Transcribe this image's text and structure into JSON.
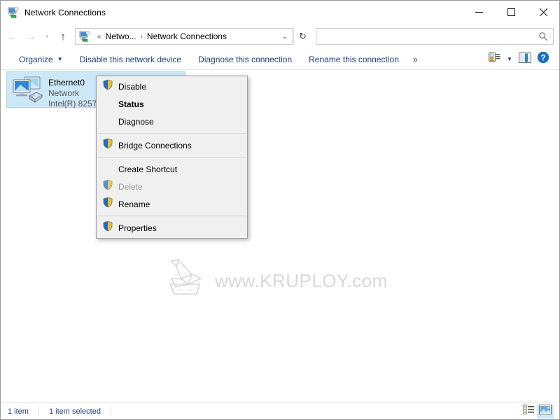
{
  "window": {
    "title": "Network Connections",
    "title_icon": "network-connections-icon",
    "minimize_label": "Minimize",
    "maximize_label": "Maximize",
    "close_label": "Close"
  },
  "navigation": {
    "back_label": "Back",
    "forward_label": "Forward",
    "recent_label": "Recent locations",
    "up_label": "Up",
    "refresh_label": "Refresh"
  },
  "address": {
    "icon": "network-connections-icon",
    "prefix": "«",
    "crumb1": "Netwo...",
    "separator": "›",
    "crumb2": "Network Connections",
    "dropdown": "⌄"
  },
  "search": {
    "value": "",
    "placeholder": "",
    "icon": "search-icon"
  },
  "toolbar": {
    "organize": "Organize",
    "organize_caret": "▼",
    "disable_device": "Disable this network device",
    "diagnose_connection": "Diagnose this connection",
    "rename_connection": "Rename this connection",
    "overflow": "»",
    "view_options": "change-view-icon",
    "view_caret": "▼",
    "preview_pane": "preview-pane-icon",
    "help": "?"
  },
  "items": [
    {
      "name": "Ethernet0",
      "network": "Network",
      "adapter": "Intel(R) 8257",
      "icon": "lan-connection-icon",
      "selected": true
    }
  ],
  "context_menu": [
    {
      "label": "Disable",
      "shield": true,
      "bold": false,
      "disabled": false,
      "sep_after": false
    },
    {
      "label": "Status",
      "shield": false,
      "bold": true,
      "disabled": false,
      "sep_after": false
    },
    {
      "label": "Diagnose",
      "shield": false,
      "bold": false,
      "disabled": false,
      "sep_after": true
    },
    {
      "label": "Bridge Connections",
      "shield": true,
      "bold": false,
      "disabled": false,
      "sep_after": true
    },
    {
      "label": "Create Shortcut",
      "shield": false,
      "bold": false,
      "disabled": false,
      "sep_after": false
    },
    {
      "label": "Delete",
      "shield": true,
      "bold": false,
      "disabled": true,
      "sep_after": false
    },
    {
      "label": "Rename",
      "shield": true,
      "bold": false,
      "disabled": false,
      "sep_after": true
    },
    {
      "label": "Properties",
      "shield": true,
      "bold": false,
      "disabled": false,
      "sep_after": false
    }
  ],
  "watermark": {
    "text": "www.KRUPLOY.com",
    "logo": "origami-bird-logo"
  },
  "statusbar": {
    "item_count": "1 item",
    "selection": "1 item selected",
    "details_view": "details-view-icon",
    "large_icons_view": "large-icons-view-icon"
  },
  "colors": {
    "accent": "#1d3f73",
    "selection": "#cce8f7",
    "selection_border": "#a6d9f0",
    "menu_bg": "#f0f0f0",
    "help_blue": "#1a6fc4",
    "shield_blue": "#1f6fc0",
    "shield_yellow": "#f5bb2b",
    "watermark_gray": "#b9b9b9"
  }
}
